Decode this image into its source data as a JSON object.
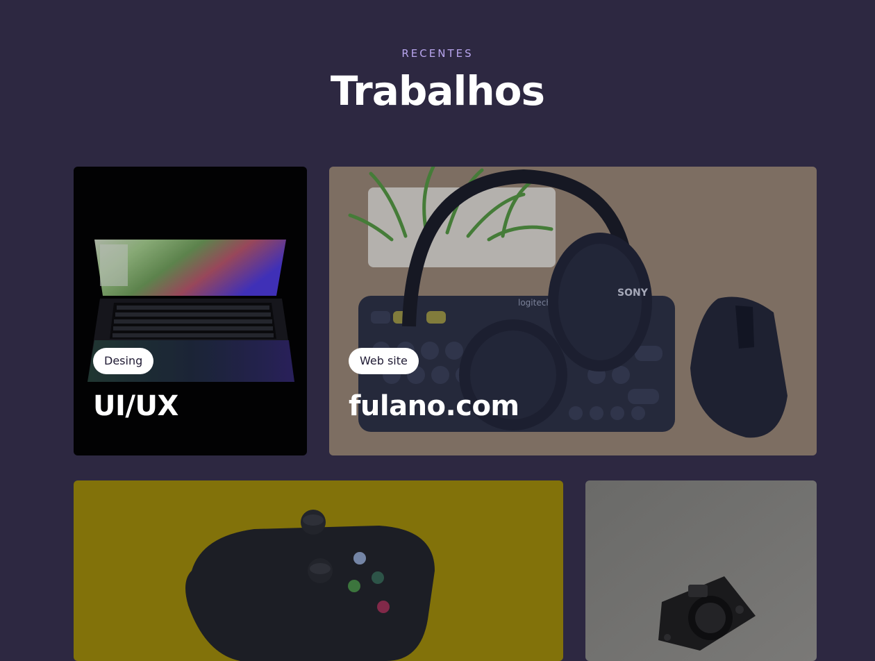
{
  "section": {
    "kicker": "RECENTES",
    "title": "Trabalhos"
  },
  "cards": [
    {
      "tag": "Desing",
      "title": "UI/UX"
    },
    {
      "tag": "Web site",
      "title": "fulano.com"
    }
  ],
  "card_images": {
    "keyboard_brand": "logitech",
    "headphones_brand": "SONY"
  },
  "colors": {
    "background": "#2d2841",
    "kicker": "#b9a6ef",
    "tag_bg": "#ffffff",
    "tag_text": "#1f1a33"
  }
}
